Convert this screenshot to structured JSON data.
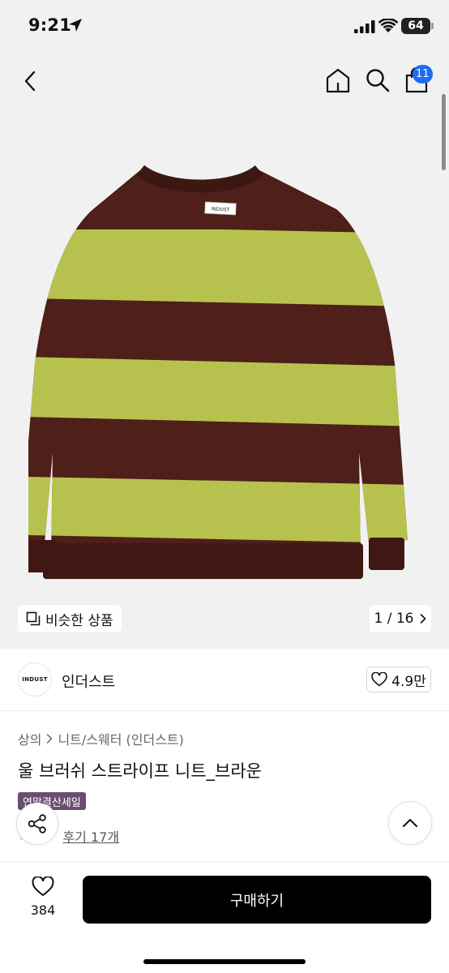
{
  "status_bar": {
    "time": "9:21",
    "battery": "64"
  },
  "nav": {
    "cart_count": "11"
  },
  "image_overlay": {
    "similar_label": "비슷한 상품",
    "counter": "1 / 16"
  },
  "brand": {
    "logo_text": "INDUST",
    "name": "인더스트",
    "like_count": "4.9만"
  },
  "product": {
    "breadcrumb": [
      "상의",
      "니트/스웨터 (인더스트)"
    ],
    "title": "울 브러쉬 스트라이프 니트_브라운",
    "sale_tag": "연말결산세일",
    "review_link": "후기 17개",
    "label_text": "INDUST"
  },
  "bottom_bar": {
    "wish_count": "384",
    "buy_label": "구매하기"
  },
  "colors": {
    "brown": "#4f1f1a",
    "green": "#b7c24e",
    "badge_blue": "#1d6bf3",
    "sale_purple": "#6b4f70"
  }
}
